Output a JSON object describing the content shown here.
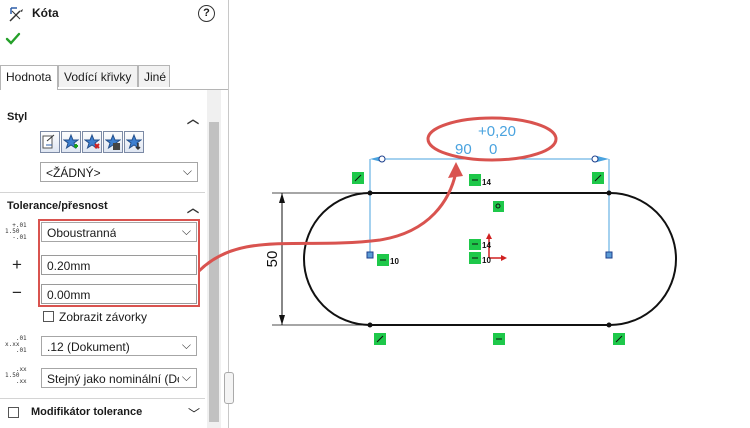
{
  "panel": {
    "title": "Kóta",
    "help_label": "?",
    "tabs": [
      "Hodnota",
      "Vodící křivky",
      "Jiné"
    ],
    "style": {
      "heading": "Styl",
      "icons": [
        "load-style-icon",
        "add-style-icon",
        "delete-style-icon",
        "save-style-icon",
        "update-style-icon"
      ],
      "selected": "<ŽÁDNÝ>"
    },
    "tolerance": {
      "heading": "Tolerance/přesnost",
      "type": "Oboustranná",
      "plus_label": "+",
      "minus_label": "−",
      "upper": "0.20mm",
      "lower": "0.00mm",
      "show_brackets_label": "Zobrazit závorky",
      "show_brackets_checked": false,
      "precision": ".12 (Dokument)",
      "tolerance_precision": "Stejný jako nominální (Do"
    },
    "modifier_label": "Modifikátor tolerance",
    "highlight_color": "#d9534f"
  },
  "drawing": {
    "dim_upper": "+0,20",
    "dim_nominal": "90",
    "dim_lower": "0",
    "vertical_dim": "50",
    "relation_labels": [
      "14",
      "10",
      "14",
      "10"
    ],
    "dim_color": "#4aa3df",
    "relation_color": "#1ec84a"
  }
}
